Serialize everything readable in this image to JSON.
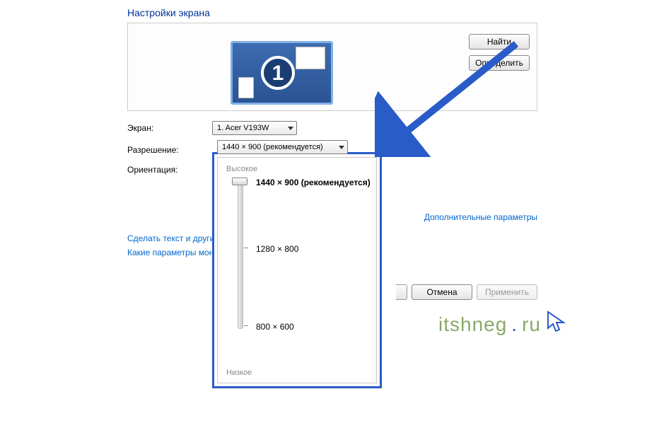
{
  "title": "Настройки экрана",
  "monitor_number": "1",
  "side_buttons": {
    "find": "Найти",
    "identify": "Определить"
  },
  "labels": {
    "screen": "Экран:",
    "resolution": "Разрешение:",
    "orientation": "Ориентация:"
  },
  "dropdowns": {
    "screen_value": "1. Acer V193W",
    "resolution_value": "1440 × 900 (рекомендуется)"
  },
  "popup": {
    "high": "Высокое",
    "low": "Низкое",
    "options": {
      "top": "1440 × 900 (рекомендуется)",
      "mid": "1280 × 800",
      "bottom": "800 × 600"
    }
  },
  "links": {
    "advanced": "Дополнительные параметры",
    "text_size": "Сделать текст и другие",
    "which_params": "Какие параметры мон"
  },
  "buttons": {
    "cancel": "Отмена",
    "apply": "Применить"
  },
  "watermark": {
    "a": "itshneg",
    "b": "ru"
  }
}
